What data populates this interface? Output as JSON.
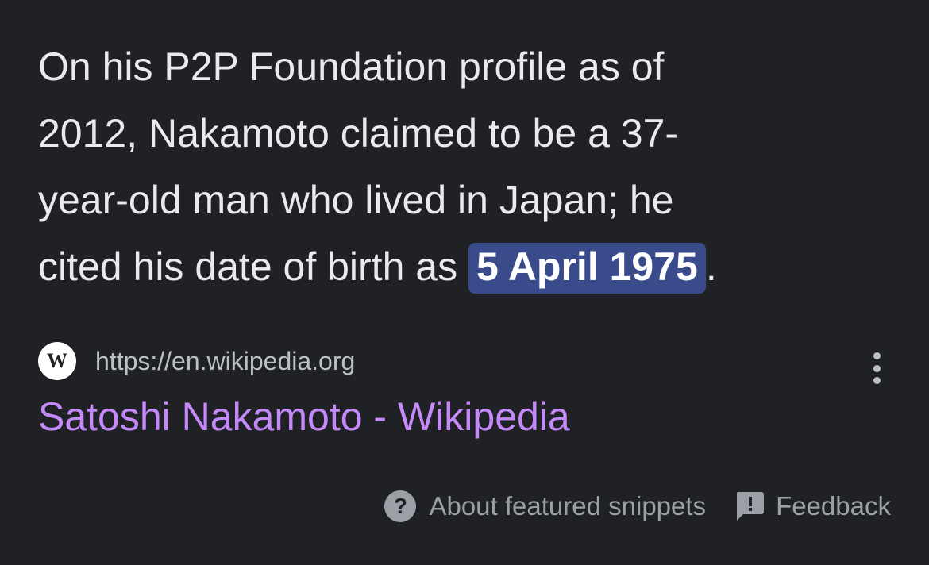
{
  "snippet": {
    "line1": "On his P2P Foundation profile as of",
    "line2": "2012, Nakamoto claimed to be a 37-",
    "line3": "year-old man who lived in Japan; he",
    "line4_before": "cited his date of birth as ",
    "line4_highlight": "5 April 1975",
    "line4_after": "."
  },
  "source": {
    "favicon_letter": "W",
    "favicon_icon": "wikipedia-icon",
    "url": "https://en.wikipedia.org"
  },
  "result": {
    "title": "Satoshi Nakamoto - Wikipedia"
  },
  "footer": {
    "help_icon": "question-mark-icon",
    "about_label": "About featured snippets",
    "feedback_icon": "feedback-icon",
    "feedback_label": "Feedback"
  },
  "colors": {
    "background": "#202124",
    "text": "#e8eaed",
    "highlight_bg": "#394b8a",
    "link": "#c58af9",
    "muted": "#9aa0a6"
  }
}
